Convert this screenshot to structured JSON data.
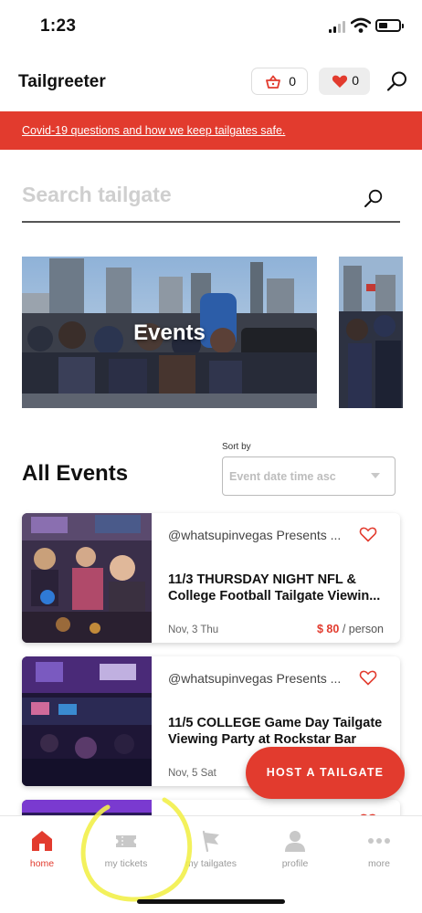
{
  "status_bar": {
    "time": "1:23"
  },
  "header": {
    "title": "Tailgreeter",
    "cart": {
      "icon": "basket-icon",
      "count": "0"
    },
    "favorites": {
      "icon": "heart-icon",
      "count": "0"
    },
    "search_icon": "search-icon"
  },
  "banner": {
    "text": "Covid-19 questions and how we keep tailgates safe."
  },
  "search": {
    "placeholder": "Search tailgate"
  },
  "carousel": {
    "slides": [
      {
        "label": "Events"
      }
    ]
  },
  "events_section": {
    "title": "All Events",
    "sort_label": "Sort by",
    "sort_value": "Event date time asc",
    "events": [
      {
        "organizer": "@whatsupinvegas Presents ...",
        "title_line1": "11/3 THURSDAY NIGHT NFL &",
        "title_line2": "College Football Tailgate Viewin...",
        "date": "Nov, 3 Thu",
        "price": "$ 80",
        "price_unit": "/ person"
      },
      {
        "organizer": "@whatsupinvegas Presents ...",
        "title_line1": "11/5 COLLEGE Game Day Tailgate",
        "title_line2": "Viewing Party at Rockstar Bar",
        "date": "Nov, 5 Sat",
        "price": "",
        "price_unit": ""
      }
    ]
  },
  "fab": {
    "label": "HOST A TAILGATE"
  },
  "bottom_nav": {
    "items": [
      {
        "label": "home",
        "icon": "home-icon",
        "active": true
      },
      {
        "label": "my tickets",
        "icon": "ticket-icon",
        "active": false
      },
      {
        "label": "my tailgates",
        "icon": "flag-icon",
        "active": false
      },
      {
        "label": "profile",
        "icon": "profile-icon",
        "active": false
      },
      {
        "label": "more",
        "icon": "more-icon",
        "active": false
      }
    ]
  },
  "colors": {
    "accent": "#e23b2e",
    "muted": "#9a9a9a",
    "annotation": "#f2f04a"
  }
}
